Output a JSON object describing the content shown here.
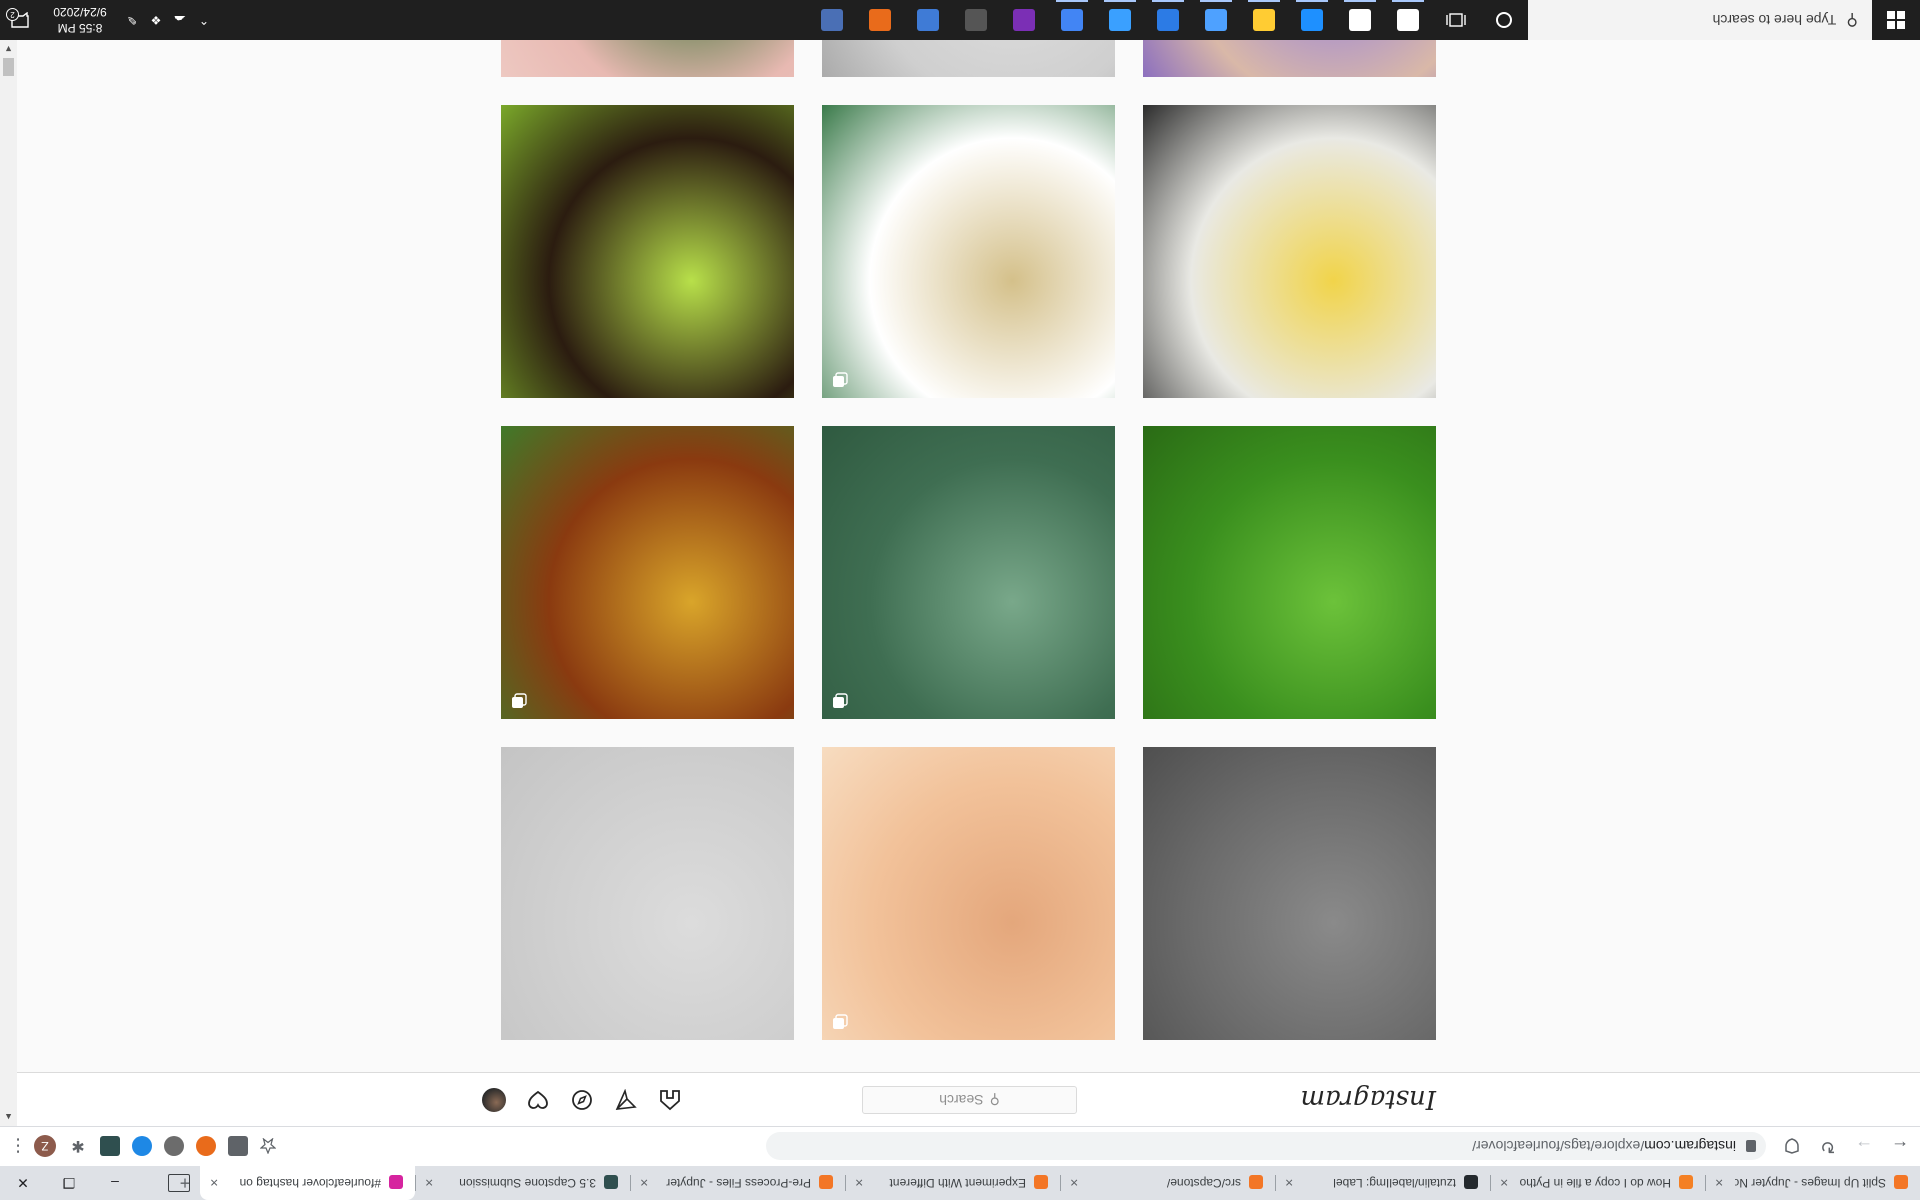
{
  "browser": {
    "tabs": [
      {
        "label": "Split Up Images - Jupyter Notebook",
        "favicon_color": "#f37626",
        "active": false
      },
      {
        "label": "How do I copy a file in Python",
        "favicon_color": "#f48024",
        "active": false
      },
      {
        "label": "tzutalin/labelImg: Label",
        "favicon_color": "#24292e",
        "active": false
      },
      {
        "label": "src/Capstone/",
        "favicon_color": "#f37626",
        "active": false
      },
      {
        "label": "Experiment With Different",
        "favicon_color": "#f37626",
        "active": false
      },
      {
        "label": "Pre-Process Files - Jupyter",
        "favicon_color": "#f37626",
        "active": false
      },
      {
        "label": "3.5 Capstone Submission",
        "favicon_color": "#2f4f4f",
        "active": false
      },
      {
        "label": "#fourleafclover hashtag on",
        "favicon_color": "#d6249f",
        "active": true
      }
    ],
    "close_glyph": "×",
    "new_tab_glyph": "+",
    "window_controls": {
      "minimize": "–",
      "restore": "❐",
      "close": "✕"
    },
    "address": {
      "host": "instagram.com",
      "path": "/explore/tags/fourleafclover/"
    },
    "profile_initial": "Z",
    "nav": {
      "back": "←",
      "forward": "→",
      "reload": "↻"
    }
  },
  "instagram": {
    "logo": "Instagram",
    "search_placeholder": "Search",
    "search_glyph": "⚲",
    "tiles": [
      {
        "desc": "partial top tile",
        "colors": [
          "#6b6b6b",
          "#8a8a8a",
          "#4f4f4f"
        ],
        "multi": false
      },
      {
        "desc": "partial top tile",
        "colors": [
          "#f2c29a",
          "#e4a77c",
          "#f7dcc0"
        ],
        "multi": true
      },
      {
        "desc": "partial top tile",
        "colors": [
          "#cfcfcf",
          "#dcdcdc",
          "#c4c4c4"
        ],
        "multi": false
      },
      {
        "desc": "clover field",
        "colors": [
          "#3a8f1e",
          "#6cc23a",
          "#2a6b15"
        ],
        "multi": false
      },
      {
        "desc": "clover leaves",
        "colors": [
          "#3f6e52",
          "#79a88a",
          "#2f5a40"
        ],
        "multi": true
      },
      {
        "desc": "clover pendant",
        "colors": [
          "#8a3a10",
          "#d9a52a",
          "#3f7a2a"
        ],
        "multi": true
      },
      {
        "desc": "poster",
        "colors": [
          "#e9e9e4",
          "#f1d44a",
          "#2c2c2c"
        ],
        "multi": false
      },
      {
        "desc": "ring",
        "colors": [
          "#ffffff",
          "#d4c08a",
          "#3a7a4a"
        ],
        "multi": true
      },
      {
        "desc": "clover closeup",
        "colors": [
          "#2b1c10",
          "#b8e04a",
          "#7aa82a"
        ],
        "multi": false
      },
      {
        "desc": "nails",
        "colors": [
          "#d9b8a8",
          "#8f7be0",
          "#6a4fc8"
        ],
        "multi": false
      },
      {
        "desc": "sketch",
        "colors": [
          "#cfcfcf",
          "#e0e0e0",
          "#9a9a9a"
        ],
        "multi": false
      },
      {
        "desc": "hand clover",
        "colors": [
          "#e8b9b2",
          "#2f6b2a",
          "#f0cfc8"
        ],
        "multi": false
      }
    ]
  },
  "taskbar": {
    "search_placeholder": "Type here to search",
    "time": "8:55 PM",
    "date": "9/24/2020",
    "notification_count": "2",
    "pinned_colors": [
      "#ffffff",
      "#ffffff",
      "#1e90ff",
      "#ffcc33",
      "#4ea1ff",
      "#2c7be5",
      "#3aa0ff",
      "#4285f4",
      "#7b2fb5",
      "#555555",
      "#3f7bd6",
      "#e96b1b",
      "#4a6fb5"
    ]
  },
  "colors": {
    "accent_blue": "#1a73e8",
    "instagram_border": "#dbdbdb"
  }
}
